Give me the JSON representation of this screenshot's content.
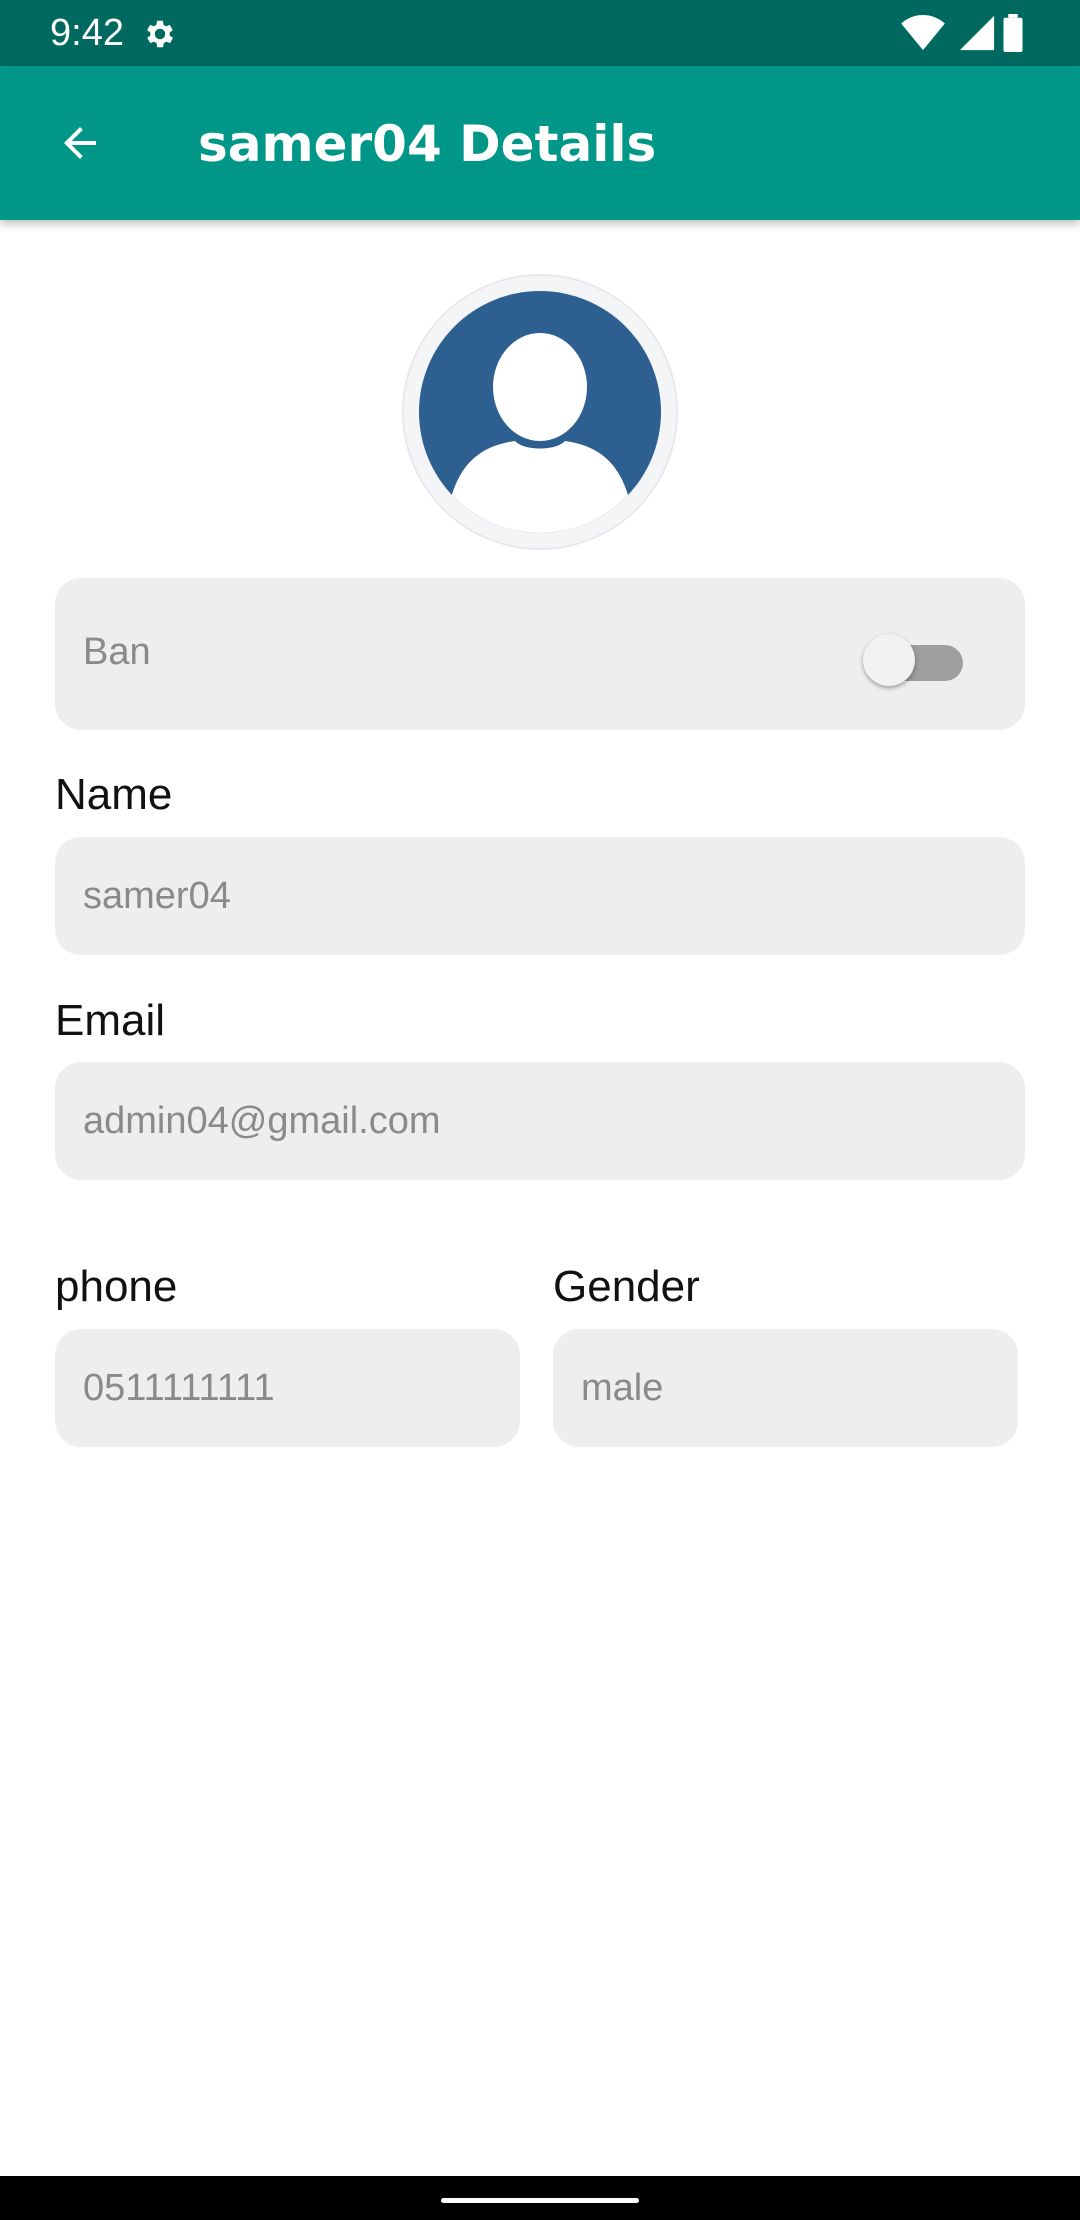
{
  "status_bar": {
    "time": "9:42",
    "icons": [
      "settings-icon",
      "wifi-icon",
      "signal-icon",
      "battery-icon"
    ]
  },
  "app_bar": {
    "title": "samer04 Details",
    "back_icon": "arrow-back-icon"
  },
  "profile": {
    "avatar_icon": "person-avatar-icon"
  },
  "ban": {
    "label": "Ban",
    "enabled": false
  },
  "fields": {
    "name": {
      "label": "Name",
      "value": "samer04"
    },
    "email": {
      "label": "Email",
      "value": "admin04@gmail.com"
    },
    "phone": {
      "label": "phone",
      "value": "0511111111"
    },
    "gender": {
      "label": "Gender",
      "value": "male"
    }
  },
  "colors": {
    "status_bar": "#00695f",
    "app_bar": "#009688",
    "avatar_blue": "#2d5f91",
    "field_bg": "#eeeeee",
    "field_text": "#8a8a8a"
  }
}
